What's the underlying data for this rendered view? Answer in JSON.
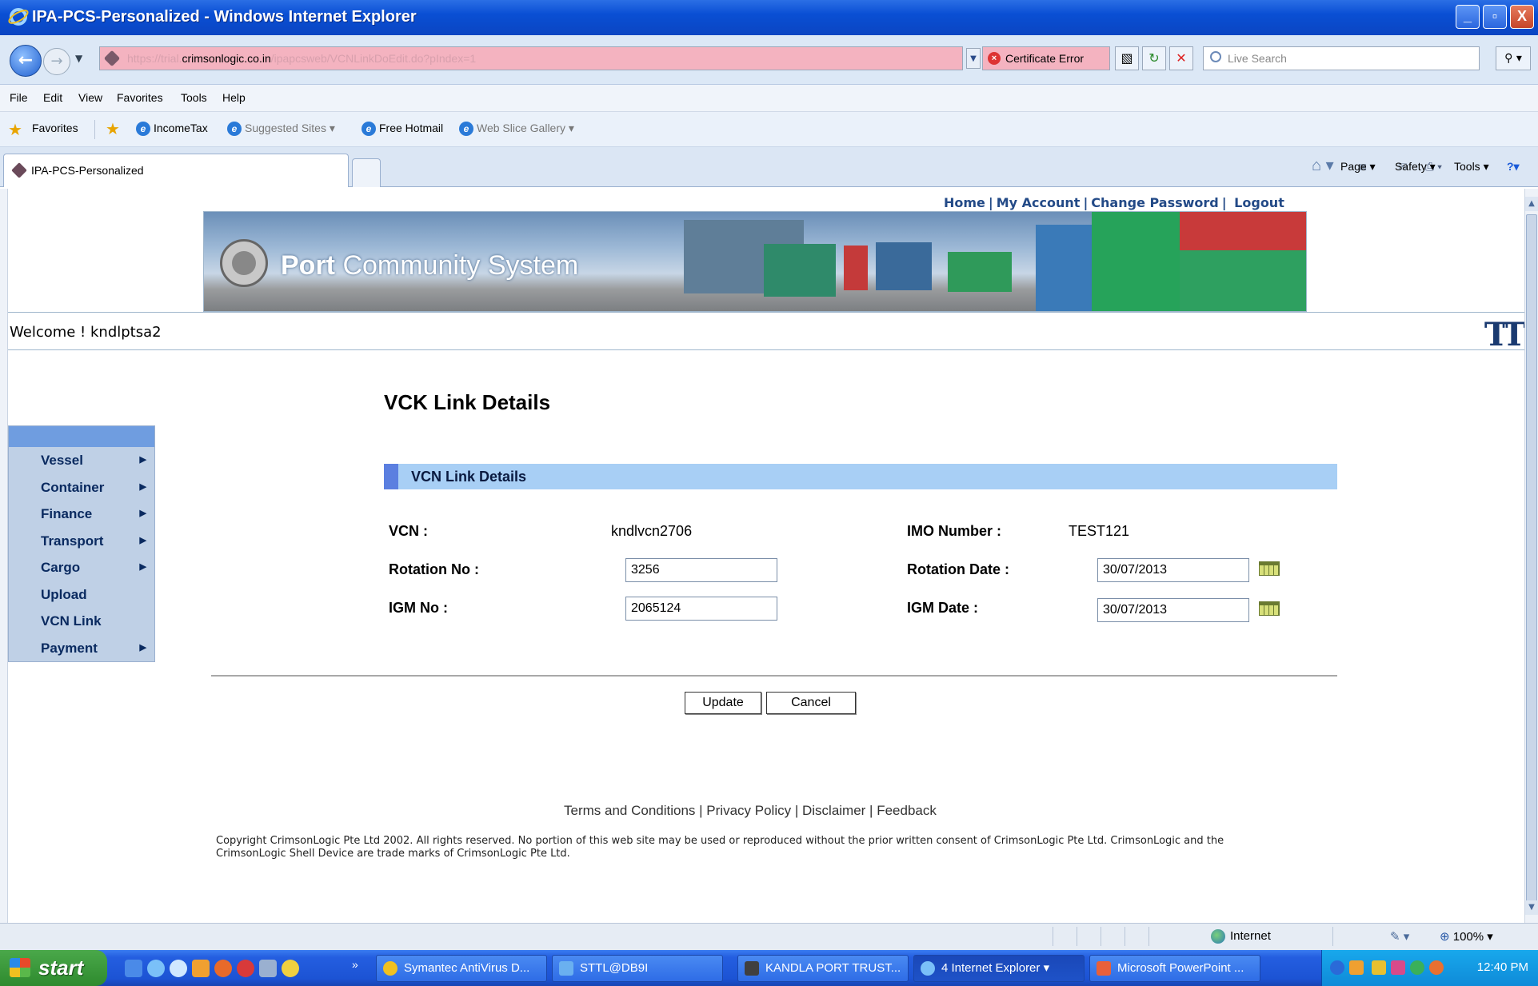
{
  "window": {
    "title": "IPA-PCS-Personalized - Windows Internet Explorer"
  },
  "address": {
    "url_prefix": "https://trial.",
    "url_domain": "crimsonlogic.co.in",
    "url_path": "/ipapcsweb/VCNLinkDoEdit.do?pIndex=1",
    "cert_label": "Certificate Error",
    "search_placeholder": "Live Search"
  },
  "menu": [
    "File",
    "Edit",
    "View",
    "Favorites",
    "Tools",
    "Help"
  ],
  "favorites": {
    "label": "Favorites",
    "items": [
      "IncomeTax",
      "Suggested Sites ▾",
      "Free Hotmail",
      "Web Slice Gallery ▾"
    ]
  },
  "tab": {
    "label": "IPA-PCS-Personalized"
  },
  "commandbar": {
    "page": "Page ▾",
    "safety": "Safety ▾",
    "tools": "Tools ▾"
  },
  "header": {
    "links": [
      "Home",
      "My Account",
      "Change Password",
      "Logout"
    ],
    "banner_bold": "Port",
    "banner_rest": " Community System",
    "welcome": "Welcome ! kndlptsa2",
    "tt_logo": "TT"
  },
  "page": {
    "heading": "VCK Link Details",
    "section_title": "VCN Link Details"
  },
  "leftnav": {
    "items": [
      {
        "label": "Vessel",
        "arrow": "▶"
      },
      {
        "label": "Container",
        "arrow": "▶"
      },
      {
        "label": "Finance",
        "arrow": "▶"
      },
      {
        "label": "Transport",
        "arrow": "▶"
      },
      {
        "label": "Cargo",
        "arrow": "▶"
      },
      {
        "label": "Upload",
        "arrow": ""
      },
      {
        "label": "VCN Link",
        "arrow": ""
      },
      {
        "label": "Payment",
        "arrow": "▶"
      }
    ]
  },
  "form": {
    "vcn_label": "VCN :",
    "vcn_value": "kndlvcn2706",
    "imo_label": "IMO Number :",
    "imo_value": "TEST121",
    "rotation_no_label": "Rotation No :",
    "rotation_no_value": "3256",
    "rotation_date_label": "Rotation Date :",
    "rotation_date_value": "30/07/2013",
    "igm_no_label": "IGM No :",
    "igm_no_value": "2065124",
    "igm_date_label": "IGM Date :",
    "igm_date_value": "30/07/2013"
  },
  "buttons": {
    "update": "Update",
    "cancel": "Cancel"
  },
  "footer": {
    "links": [
      "Terms and Conditions",
      "Privacy Policy",
      "Disclaimer",
      "Feedback"
    ],
    "copyright_line1": "Copyright CrimsonLogic Pte Ltd 2002. All rights reserved. No portion of this web site may be used or reproduced without the prior written consent of CrimsonLogic Pte Ltd. CrimsonLogic and the",
    "copyright_line2": "CrimsonLogic Shell Device are trade marks of CrimsonLogic Pte Ltd."
  },
  "statusbar": {
    "zone": "Internet",
    "zoom": "100%"
  },
  "taskbar": {
    "start": "start",
    "tasks": [
      "Symantec AntiVirus D...",
      "STTL@DB9I",
      "KANDLA PORT TRUST...",
      "4 Internet Explorer",
      "Microsoft PowerPoint ..."
    ],
    "clock": "12:40 PM"
  },
  "colors": {
    "section_bar": "#a8cff5",
    "nav_bg": "#bfd0e6",
    "link": "#234a87"
  }
}
